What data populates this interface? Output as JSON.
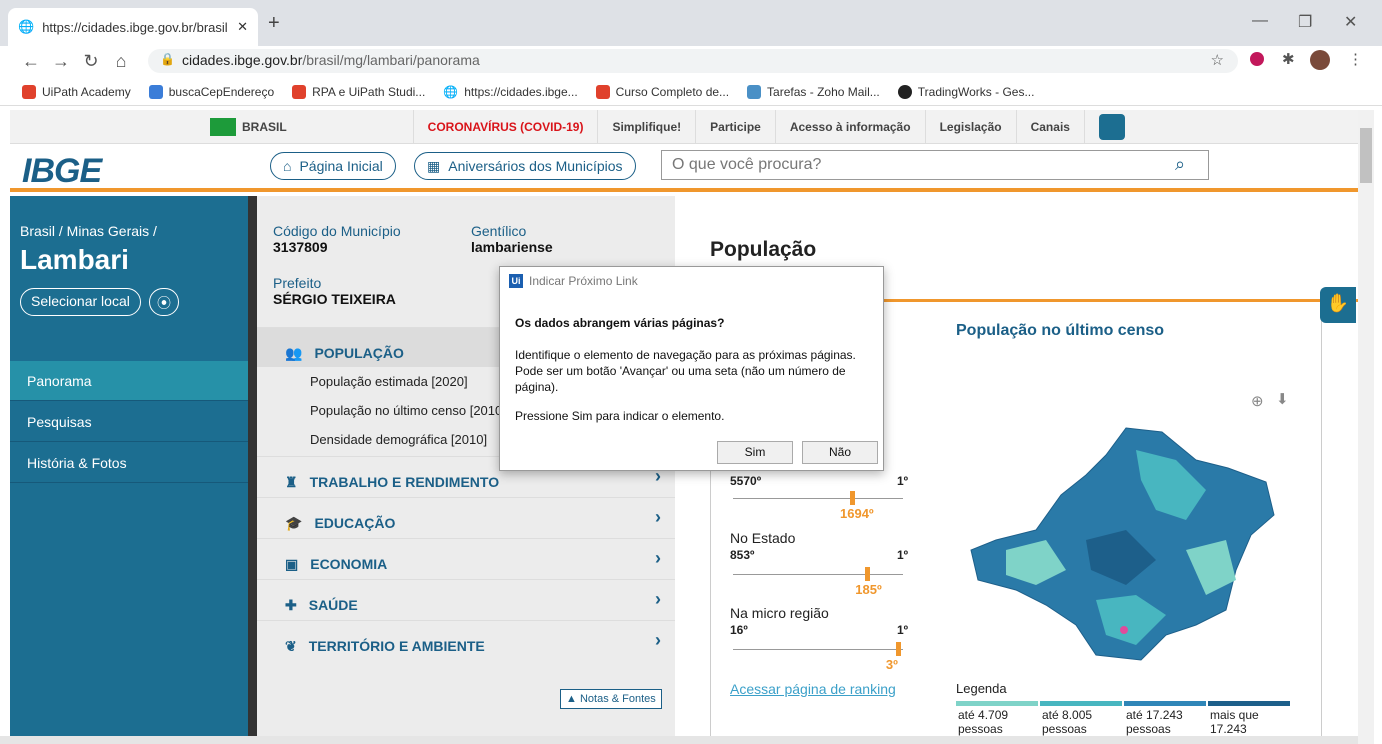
{
  "browser": {
    "tab_title": "https://cidades.ibge.gov.br/brasil",
    "url_domain": "cidades.ibge.gov.br",
    "url_path": "/brasil/mg/lambari/panorama",
    "bookmarks": [
      "UiPath Academy",
      "buscaCepEndereço",
      "RPA e UiPath Studi...",
      "https://cidades.ibge...",
      "Curso Completo de...",
      "Tarefas - Zoho Mail...",
      "TradingWorks - Ges..."
    ]
  },
  "topnav": {
    "brasil": "BRASIL",
    "items": [
      "CORONAVÍRUS (COVID-19)",
      "Simplifique!",
      "Participe",
      "Acesso à informação",
      "Legislação",
      "Canais"
    ]
  },
  "header": {
    "logo": "IBGE",
    "home": "Página Inicial",
    "aniversarios": "Aniversários dos Municípios",
    "search_placeholder": "O que você procura?"
  },
  "left": {
    "breadcrumb": "Brasil / Minas Gerais /",
    "city": "Lambari",
    "select": "Selecionar local",
    "nav": [
      "Panorama",
      "Pesquisas",
      "História & Fotos"
    ]
  },
  "info": {
    "codigo_label": "Código do Município",
    "codigo": "3137809",
    "gentilico_label": "Gentílico",
    "gentilico": "lambariense",
    "prefeito_label": "Prefeito",
    "prefeito": "SÉRGIO TEIXEIRA"
  },
  "categories": [
    "POPULAÇÃO",
    "TRABALHO E RENDIMENTO",
    "EDUCAÇÃO",
    "ECONOMIA",
    "SAÚDE",
    "TERRITÓRIO E AMBIENTE"
  ],
  "subitems": [
    "População estimada [2020]",
    "População no último censo [2010",
    "Densidade demográfica [2010]"
  ],
  "notas": "Notas & Fontes",
  "main": {
    "title": "População",
    "chart_title": "População no último censo",
    "ranking_link": "Acessar página de ranking",
    "legenda": "Legenda"
  },
  "rankings": [
    {
      "label": "",
      "max": "5570º",
      "min": "1º",
      "value": "1694º",
      "position": 0.7
    },
    {
      "label": "No Estado",
      "max": "853º",
      "min": "1º",
      "value": "185º",
      "position": 0.79
    },
    {
      "label": "Na micro região",
      "max": "16º",
      "min": "1º",
      "value": "3º",
      "position": 0.97
    }
  ],
  "legend": [
    {
      "text": "até 4.709 pessoas",
      "color": "#7fd3c8"
    },
    {
      "text": "até 8.005 pessoas",
      "color": "#48b6c0"
    },
    {
      "text": "até 17.243 pessoas",
      "color": "#2f86b8"
    },
    {
      "text": "mais que 17.243",
      "color": "#1d5f8a"
    }
  ],
  "dialog": {
    "title": "Indicar Próximo Link",
    "question": "Os dados abrangem várias páginas?",
    "body": "Identifique o elemento de navegação para as próximas páginas. Pode ser um botão 'Avançar' ou uma seta (não um número de página).",
    "press": "Pressione Sim para indicar o elemento.",
    "yes": "Sim",
    "no": "Não"
  }
}
